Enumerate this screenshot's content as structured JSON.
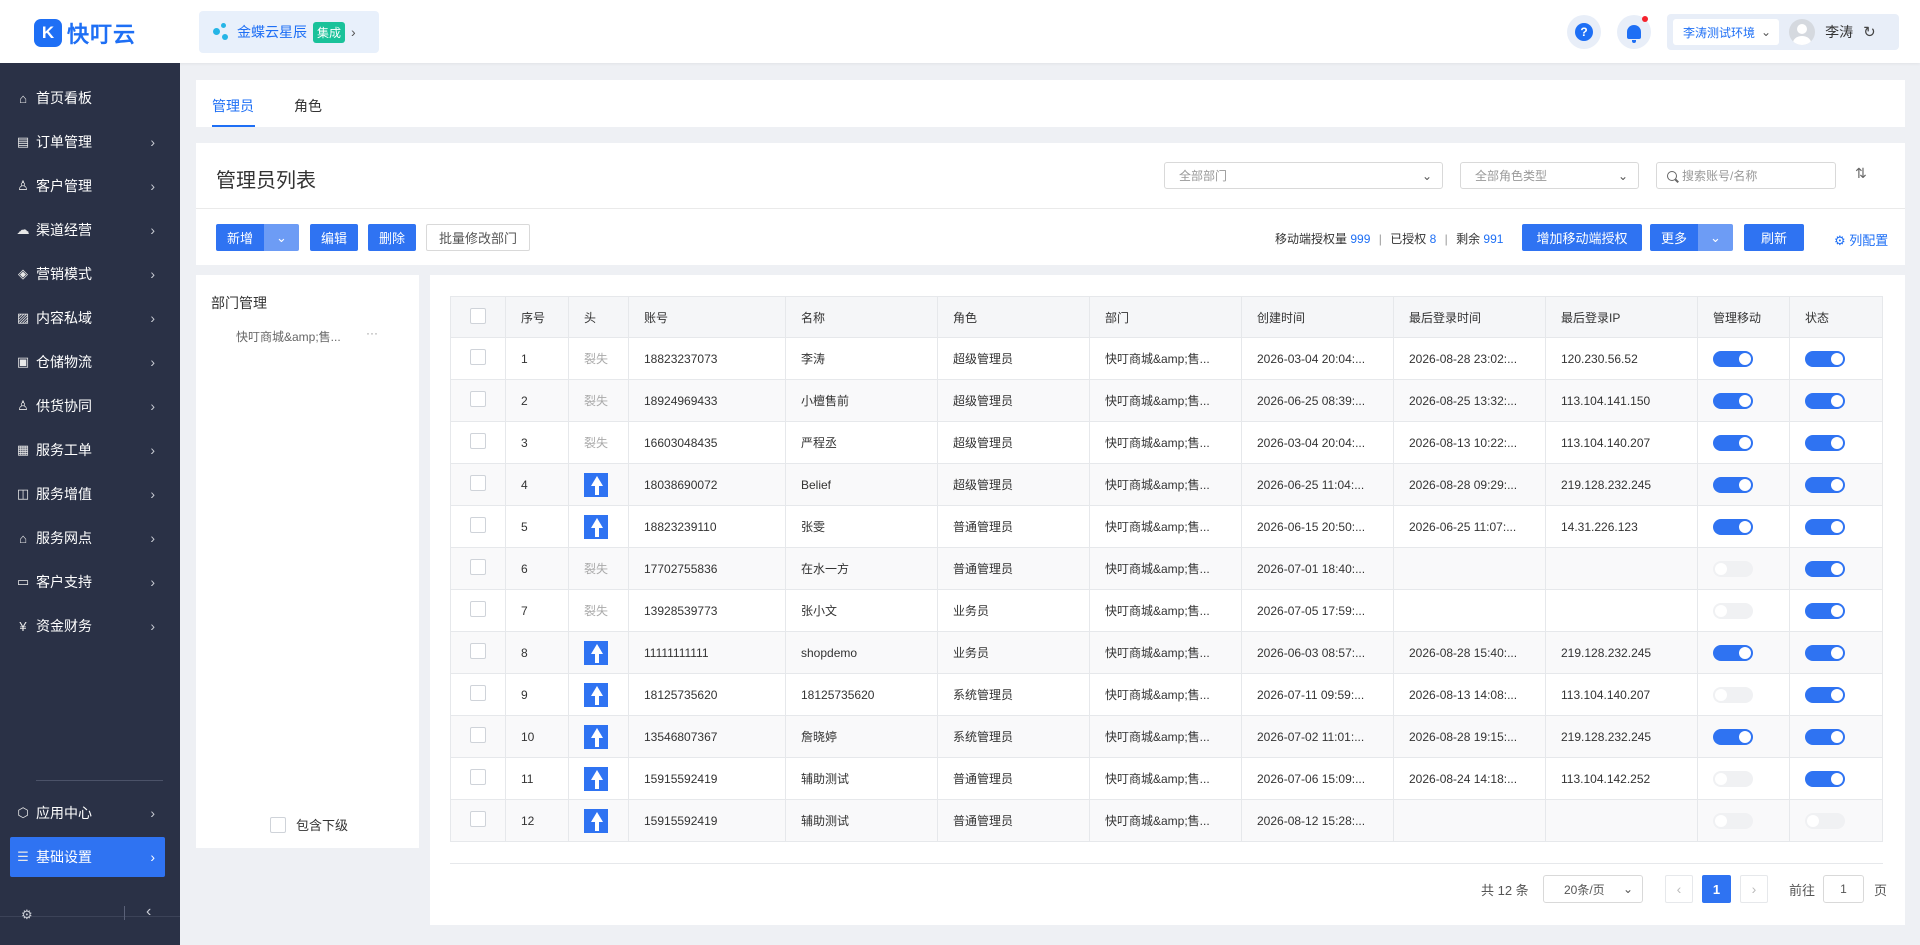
{
  "header": {
    "logo_text": "快叮云",
    "logo_glyph": "K",
    "integration_name": "金蝶云星辰",
    "integration_badge": "集成",
    "help_glyph": "?",
    "env_label": "李涛测试环境",
    "user_name": "李涛"
  },
  "sidebar": {
    "items": [
      {
        "label": "首页看板",
        "icon": "home-icon"
      },
      {
        "label": "订单管理",
        "icon": "order-icon"
      },
      {
        "label": "客户管理",
        "icon": "customer-icon"
      },
      {
        "label": "渠道经营",
        "icon": "channel-icon"
      },
      {
        "label": "营销模式",
        "icon": "tag-icon"
      },
      {
        "label": "内容私域",
        "icon": "image-icon"
      },
      {
        "label": "仓储物流",
        "icon": "warehouse-icon"
      },
      {
        "label": "供货协同",
        "icon": "supply-icon"
      },
      {
        "label": "服务工单",
        "icon": "ticket-icon"
      },
      {
        "label": "服务增值",
        "icon": "bag-icon"
      },
      {
        "label": "服务网点",
        "icon": "store-icon"
      },
      {
        "label": "客户支持",
        "icon": "support-icon"
      },
      {
        "label": "资金财务",
        "icon": "yen-icon"
      }
    ],
    "app_center": "应用中心",
    "basic_settings": "基础设置"
  },
  "tabs": {
    "admin": "管理员",
    "role": "角色"
  },
  "list": {
    "title": "管理员列表",
    "dept_filter": "全部部门",
    "role_filter": "全部角色类型",
    "search_placeholder": "搜索账号/名称"
  },
  "toolbar": {
    "add": "新增",
    "edit": "编辑",
    "delete": "删除",
    "batch_dept": "批量修改部门",
    "quota_label": "移动端授权量",
    "quota_total": "999",
    "authorized_label": "已授权",
    "authorized": "8",
    "remaining_label": "剩余",
    "remaining": "991",
    "add_mobile_auth": "增加移动端授权",
    "more": "更多",
    "refresh": "刷新",
    "column_config": "列配置"
  },
  "dept": {
    "title": "部门管理",
    "node": "快叮商城&amp;售...",
    "more": "···",
    "include_sub": "包含下级"
  },
  "table": {
    "headers": [
      "序号",
      "头",
      "账号",
      "名称",
      "角色",
      "部门",
      "创建时间",
      "最后登录时间",
      "最后登录IP",
      "管理移动",
      "状态"
    ],
    "lost_text": "裂失",
    "rows": [
      {
        "no": "1",
        "avatar": "lost",
        "account": "18823237073",
        "name": "李涛",
        "role": "超级管理员",
        "dept": "快叮商城&amp;售...",
        "created": "2026-03-04 20:04:...",
        "last_login": "2026-08-28 23:02:...",
        "ip": "120.230.56.52",
        "mobile": true,
        "status": true
      },
      {
        "no": "2",
        "avatar": "lost",
        "account": "18924969433",
        "name": "小檀售前",
        "role": "超级管理员",
        "dept": "快叮商城&amp;售...",
        "created": "2026-06-25 08:39:...",
        "last_login": "2026-08-25 13:32:...",
        "ip": "113.104.141.150",
        "mobile": true,
        "status": true
      },
      {
        "no": "3",
        "avatar": "lost",
        "account": "16603048435",
        "name": "严程丞",
        "role": "超级管理员",
        "dept": "快叮商城&amp;售...",
        "created": "2026-03-04 20:04:...",
        "last_login": "2026-08-13 10:22:...",
        "ip": "113.104.140.207",
        "mobile": true,
        "status": true
      },
      {
        "no": "4",
        "avatar": "pic",
        "account": "18038690072",
        "name": "Belief",
        "role": "超级管理员",
        "dept": "快叮商城&amp;售...",
        "created": "2026-06-25 11:04:...",
        "last_login": "2026-08-28 09:29:...",
        "ip": "219.128.232.245",
        "mobile": true,
        "status": true
      },
      {
        "no": "5",
        "avatar": "pic",
        "account": "18823239110",
        "name": "张雯",
        "role": "普通管理员",
        "dept": "快叮商城&amp;售...",
        "created": "2026-06-15 20:50:...",
        "last_login": "2026-06-25 11:07:...",
        "ip": "14.31.226.123",
        "mobile": true,
        "status": true
      },
      {
        "no": "6",
        "avatar": "lost",
        "account": "17702755836",
        "name": "在水一方",
        "role": "普通管理员",
        "dept": "快叮商城&amp;售...",
        "created": "2026-07-01 18:40:...",
        "last_login": "",
        "ip": "",
        "mobile": false,
        "status": true
      },
      {
        "no": "7",
        "avatar": "lost",
        "account": "13928539773",
        "name": "张小文",
        "role": "业务员",
        "dept": "快叮商城&amp;售...",
        "created": "2026-07-05 17:59:...",
        "last_login": "",
        "ip": "",
        "mobile": false,
        "status": true
      },
      {
        "no": "8",
        "avatar": "pic",
        "account": "11111111111",
        "name": "shopdemo",
        "role": "业务员",
        "dept": "快叮商城&amp;售...",
        "created": "2026-06-03 08:57:...",
        "last_login": "2026-08-28 15:40:...",
        "ip": "219.128.232.245",
        "mobile": true,
        "status": true
      },
      {
        "no": "9",
        "avatar": "pic",
        "account": "18125735620",
        "name": "18125735620",
        "role": "系统管理员",
        "dept": "快叮商城&amp;售...",
        "created": "2026-07-11 09:59:...",
        "last_login": "2026-08-13 14:08:...",
        "ip": "113.104.140.207",
        "mobile": false,
        "status": true
      },
      {
        "no": "10",
        "avatar": "pic",
        "account": "13546807367",
        "name": "詹晓婷",
        "role": "系统管理员",
        "dept": "快叮商城&amp;售...",
        "created": "2026-07-02 11:01:...",
        "last_login": "2026-08-28 19:15:...",
        "ip": "219.128.232.245",
        "mobile": true,
        "status": true
      },
      {
        "no": "11",
        "avatar": "pic",
        "account": "15915592419",
        "name": "辅助测试",
        "role": "普通管理员",
        "dept": "快叮商城&amp;售...",
        "created": "2026-07-06 15:09:...",
        "last_login": "2026-08-24 14:18:...",
        "ip": "113.104.142.252",
        "mobile": false,
        "status": true
      },
      {
        "no": "12",
        "avatar": "pic",
        "account": "15915592419",
        "name": "辅助测试",
        "role": "普通管理员",
        "dept": "快叮商城&amp;售...",
        "created": "2026-08-12 15:28:...",
        "last_login": "",
        "ip": "",
        "mobile": false,
        "status": false
      }
    ]
  },
  "pagination": {
    "total": "共 12 条",
    "page_size": "20条/页",
    "current": "1",
    "goto_label": "前往",
    "goto_value": "1",
    "page_unit": "页"
  },
  "colors": {
    "primary": "#2f73f2",
    "sidebar_bg": "#2a3146",
    "switch_off": "#f0f1f3"
  }
}
